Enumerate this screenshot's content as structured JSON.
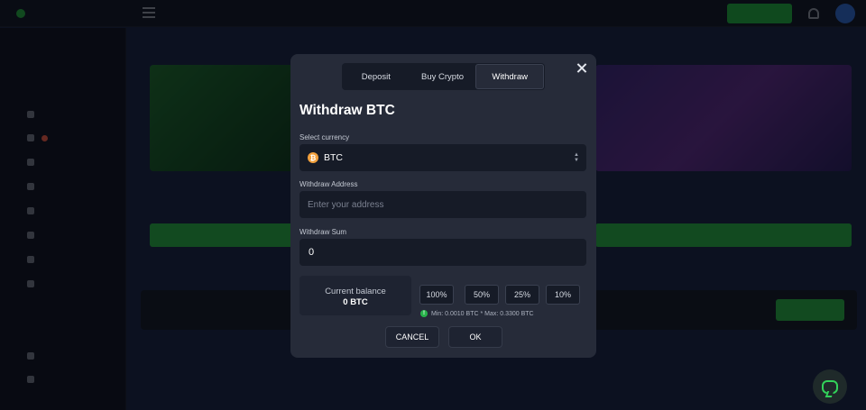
{
  "modal": {
    "tabs": [
      {
        "label": "Deposit",
        "active": false
      },
      {
        "label": "Buy Crypto",
        "active": false
      },
      {
        "label": "Withdraw",
        "active": true
      }
    ],
    "title": "Withdraw BTC",
    "currency_label": "Select currency",
    "currency_value": "BTC",
    "currency_icon": "bitcoin-icon",
    "address_label": "Withdraw Address",
    "address_placeholder": "Enter your address",
    "address_value": "",
    "sum_label": "Withdraw Sum",
    "sum_value": "0",
    "balance_label": "Current balance",
    "balance_value": "0 BTC",
    "percent_buttons": [
      "100%",
      "50%",
      "25%",
      "10%"
    ],
    "limits": "Min: 0.0010 BTC * Max: 0.3300 BTC",
    "cancel_label": "CANCEL",
    "ok_label": "OK"
  },
  "colors": {
    "modal_bg": "#262b39",
    "field_bg": "#161b27",
    "accent_green": "#27a446",
    "bitcoin_orange": "#f2a03d"
  }
}
